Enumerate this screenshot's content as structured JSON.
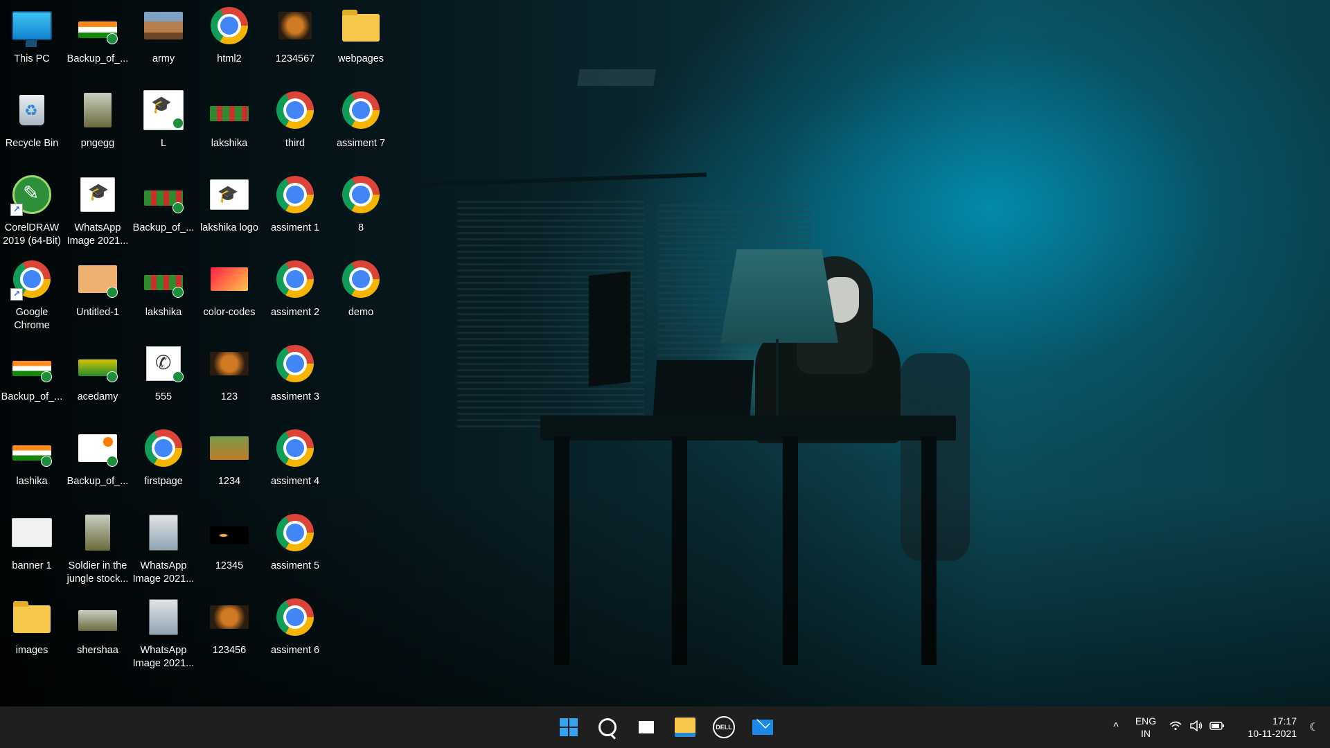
{
  "desktop": {
    "icons": [
      {
        "label": "This PC"
      },
      {
        "label": "Recycle Bin"
      },
      {
        "label": "CorelDRAW 2019 (64-Bit)"
      },
      {
        "label": "Google Chrome"
      },
      {
        "label": "Backup_of_..."
      },
      {
        "label": "lashika"
      },
      {
        "label": "banner 1"
      },
      {
        "label": "images"
      },
      {
        "label": "Backup_of_..."
      },
      {
        "label": "pngegg"
      },
      {
        "label": "WhatsApp Image 2021..."
      },
      {
        "label": "Untitled-1"
      },
      {
        "label": "acedamy"
      },
      {
        "label": "Backup_of_..."
      },
      {
        "label": "Soldier in the jungle stock..."
      },
      {
        "label": "shershaa"
      },
      {
        "label": "army"
      },
      {
        "label": "L"
      },
      {
        "label": "Backup_of_..."
      },
      {
        "label": "lakshika"
      },
      {
        "label": "555"
      },
      {
        "label": "firstpage"
      },
      {
        "label": "WhatsApp Image 2021..."
      },
      {
        "label": "WhatsApp Image 2021..."
      },
      {
        "label": "html2"
      },
      {
        "label": "lakshika"
      },
      {
        "label": "lakshika logo"
      },
      {
        "label": "color-codes"
      },
      {
        "label": "123"
      },
      {
        "label": "1234"
      },
      {
        "label": "12345"
      },
      {
        "label": "123456"
      },
      {
        "label": "1234567"
      },
      {
        "label": "third"
      },
      {
        "label": "assiment 1"
      },
      {
        "label": "assiment 2"
      },
      {
        "label": "assiment 3"
      },
      {
        "label": "assiment 4"
      },
      {
        "label": "assiment 5"
      },
      {
        "label": "assiment 6"
      },
      {
        "label": "webpages"
      },
      {
        "label": "assiment 7"
      },
      {
        "label": "8"
      },
      {
        "label": "demo"
      }
    ]
  },
  "taskbar": {
    "pinned": [
      {
        "icon": "windows-start-icon"
      },
      {
        "icon": "search-icon"
      },
      {
        "icon": "task-view-icon"
      },
      {
        "icon": "file-explorer-icon"
      },
      {
        "icon": "dell-icon"
      },
      {
        "icon": "mail-icon"
      }
    ],
    "dell_text": "DELL",
    "tray": {
      "chevron": "^",
      "lang_line1": "ENG",
      "lang_line2": "IN",
      "time": "17:17",
      "date": "10-11-2021"
    }
  },
  "colors": {
    "taskbar_bg": "#1f1f1f",
    "accent": "#35a3f0"
  }
}
